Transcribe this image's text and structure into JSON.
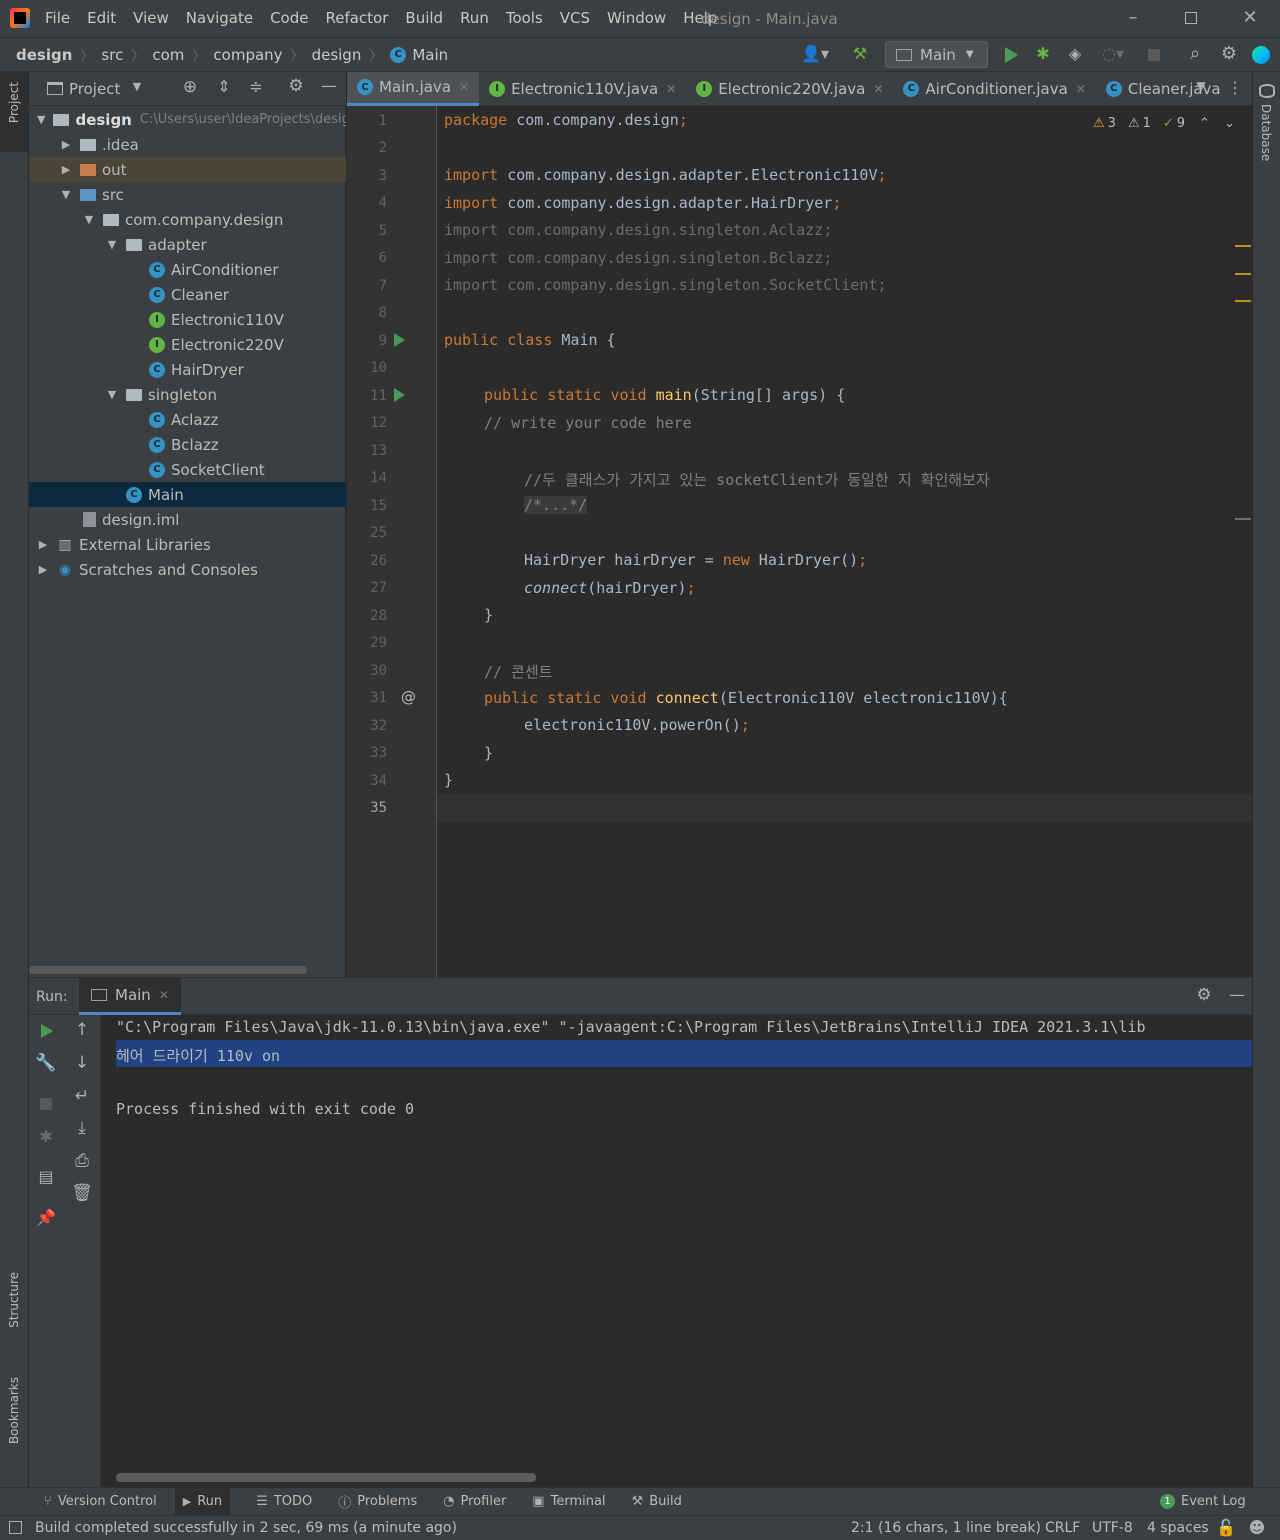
{
  "titlebar": {
    "app_icon": "intellij-idea-icon",
    "menu": [
      "File",
      "Edit",
      "View",
      "Navigate",
      "Code",
      "Refactor",
      "Build",
      "Run",
      "Tools",
      "VCS",
      "Window",
      "Help"
    ],
    "title": "design - Main.java"
  },
  "breadcrumb": [
    "design",
    "src",
    "com",
    "company",
    "design",
    "Main"
  ],
  "toolbar": {
    "run_config": "Main"
  },
  "left_strip": {
    "project": "Project",
    "structure": "Structure",
    "bookmarks": "Bookmarks"
  },
  "right_strip": {
    "database": "Database"
  },
  "project_panel": {
    "title": "Project",
    "root_name": "design",
    "root_path": "C:\\Users\\user\\IdeaProjects\\design",
    "items": [
      {
        "label": ".idea",
        "icon": "folder"
      },
      {
        "label": "out",
        "icon": "folder-orange"
      },
      {
        "label": "src",
        "icon": "folder-blue"
      },
      {
        "label": "com.company.design",
        "icon": "package"
      },
      {
        "label": "adapter",
        "icon": "package"
      },
      {
        "label": "AirConditioner",
        "icon": "class"
      },
      {
        "label": "Cleaner",
        "icon": "class"
      },
      {
        "label": "Electronic110V",
        "icon": "interface"
      },
      {
        "label": "Electronic220V",
        "icon": "interface"
      },
      {
        "label": "HairDryer",
        "icon": "class"
      },
      {
        "label": "singleton",
        "icon": "package"
      },
      {
        "label": "Aclazz",
        "icon": "class"
      },
      {
        "label": "Bclazz",
        "icon": "class"
      },
      {
        "label": "SocketClient",
        "icon": "class"
      },
      {
        "label": "Main",
        "icon": "class-run"
      },
      {
        "label": "design.iml",
        "icon": "iml-file"
      },
      {
        "label": "External Libraries",
        "icon": "libraries"
      },
      {
        "label": "Scratches and Consoles",
        "icon": "scratches"
      }
    ]
  },
  "tabs": [
    {
      "label": "Main.java",
      "icon": "class"
    },
    {
      "label": "Electronic110V.java",
      "icon": "interface"
    },
    {
      "label": "Electronic220V.java",
      "icon": "interface"
    },
    {
      "label": "AirConditioner.java",
      "icon": "class"
    },
    {
      "label": "Cleaner.java",
      "icon": "class"
    }
  ],
  "inspections": {
    "warnings": "3",
    "weak_warnings": "1",
    "typos": "9"
  },
  "editor": {
    "line_numbers": [
      "1",
      "2",
      "3",
      "4",
      "5",
      "6",
      "7",
      "8",
      "9",
      "10",
      "11",
      "12",
      "13",
      "14",
      "15",
      "25",
      "26",
      "27",
      "28",
      "29",
      "30",
      "31",
      "32",
      "33",
      "34",
      "35"
    ],
    "l1_kw": "package",
    "l1_rest": " com.company.design",
    "import_kw": "import",
    "l3_rest": " com.company.design.adapter.Electronic110V",
    "l4_rest": " com.company.design.adapter.HairDryer",
    "l5": "import com.company.design.singleton.Aclazz;",
    "l6": "import com.company.design.singleton.Bclazz;",
    "l7": "import com.company.design.singleton.SocketClient;",
    "l9_kw": "public class",
    "l9_rest": " Main {",
    "l11_kw": "public static void",
    "l11_fn": "main",
    "l11_rest": "(String[] args) {",
    "l12": "// write your code here",
    "l14": "//두 클래스가 가지고 있는 socketClient가 동일한 지 확인해보자",
    "l15": "/*...*/",
    "l26_a": "HairDryer hairDryer = ",
    "l26_kw": "new",
    "l26_b": " HairDryer()",
    "l27_fn": "connect",
    "l27_rest": "(hairDryer)",
    "semicolon": ";",
    "close_brace": "}",
    "l30": "// 콘센트",
    "l31_kw": "public static void",
    "l31_fn": "connect",
    "l31_rest": "(Electronic110V electronic110V){",
    "l32_a": "electronic110V.powerOn()"
  },
  "run_panel": {
    "label": "Run:",
    "tab": "Main",
    "console": [
      "\"C:\\Program Files\\Java\\jdk-11.0.13\\bin\\java.exe\" \"-javaagent:C:\\Program Files\\JetBrains\\IntelliJ IDEA 2021.3.1\\lib",
      "헤어 드라이기 110v on",
      "",
      "Process finished with exit code 0"
    ]
  },
  "bottom_tabs": [
    "Version Control",
    "Run",
    "TODO",
    "Problems",
    "Profiler",
    "Terminal",
    "Build"
  ],
  "event_log": {
    "count": "1",
    "label": "Event Log"
  },
  "status": {
    "message": "Build completed successfully in 2 sec, 69 ms (a minute ago)",
    "position": "2:1 (16 chars, 1 line break)",
    "line_sep": "CRLF",
    "encoding": "UTF-8",
    "indent": "4 spaces"
  },
  "colors": {
    "accent": "#4a88c7",
    "run_green": "#499c54",
    "selection": "#214283"
  }
}
